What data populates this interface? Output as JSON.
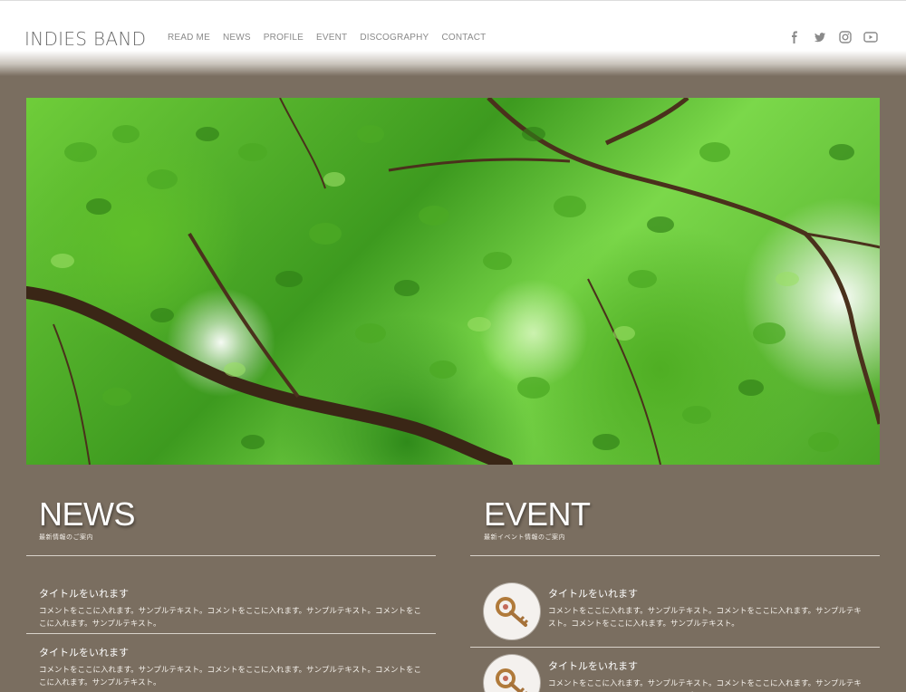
{
  "header": {
    "logo": "INDIES BAND",
    "nav": [
      "READ ME",
      "NEWS",
      "PROFILE",
      "EVENT",
      "DISCOGRAPHY",
      "CONTACT"
    ],
    "social": [
      {
        "name": "facebook-icon"
      },
      {
        "name": "twitter-icon"
      },
      {
        "name": "instagram-icon"
      },
      {
        "name": "youtube-icon"
      }
    ]
  },
  "hero": {
    "image": "green-leaves-canopy"
  },
  "news": {
    "title": "NEWS",
    "subtitle": "最新情報のご案内",
    "items": [
      {
        "title": "タイトルをいれます",
        "text": "コメントをここに入れます。サンプルテキスト。コメントをここに入れます。サンプルテキスト。コメントをここに入れます。サンプルテキスト。"
      },
      {
        "title": "タイトルをいれます",
        "text": "コメントをここに入れます。サンプルテキスト。コメントをここに入れます。サンプルテキスト。コメントをここに入れます。サンプルテキスト。"
      }
    ]
  },
  "event": {
    "title": "EVENT",
    "subtitle": "最新イベント情報のご案内",
    "items": [
      {
        "title": "タイトルをいれます",
        "text": "コメントをここに入れます。サンプルテキスト。コメントをここに入れます。サンプルテキスト。コメントをここに入れます。サンプルテキスト。"
      },
      {
        "title": "タイトルをいれます",
        "text": "コメントをここに入れます。サンプルテキスト。コメントをここに入れます。サンプルテキスト。コメントをここに入れます。サンプルテキスト。"
      }
    ]
  },
  "colors": {
    "background": "#7a6e60",
    "header": "#ffffff",
    "text": "#ffffff"
  }
}
